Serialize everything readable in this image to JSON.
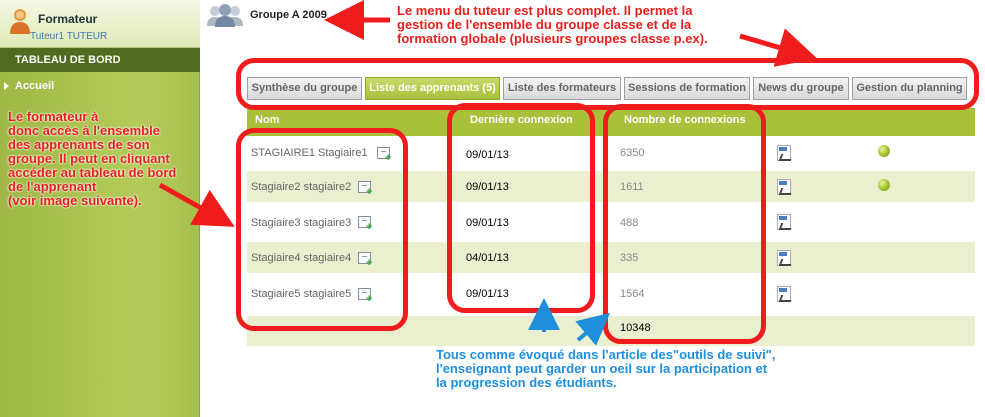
{
  "sidebar": {
    "role": "Formateur",
    "user": "Tuteur1 TUTEUR",
    "section_title": "TABLEAU DE BORD",
    "nav_item": "Accueil"
  },
  "header": {
    "group_name": "Groupe A 2009"
  },
  "tabs": [
    {
      "label": "Synthèse du groupe",
      "active": false
    },
    {
      "label": "Liste des apprenants (5)",
      "active": true
    },
    {
      "label": "Liste des formateurs",
      "active": false
    },
    {
      "label": "Sessions de formation",
      "active": false
    },
    {
      "label": "News du groupe",
      "active": false
    },
    {
      "label": "Gestion du planning",
      "active": false
    }
  ],
  "table": {
    "columns": [
      "Nom",
      "Dernière connexion",
      "Nombre de connexions"
    ],
    "rows": [
      {
        "name": "STAGIAIRE1 Stagiaire1",
        "last": "09/01/13",
        "count": "6350",
        "pdf": true,
        "dot": true
      },
      {
        "name": "Stagiaire2 stagiaire2",
        "last": "09/01/13",
        "count": "1611",
        "pdf": true,
        "dot": true
      },
      {
        "name": "Stagiaire3 stagiaire3",
        "last": "09/01/13",
        "count": "488",
        "pdf": true,
        "dot": false
      },
      {
        "name": "Stagiaire4 stagiaire4",
        "last": "04/01/13",
        "count": "335",
        "pdf": true,
        "dot": false
      },
      {
        "name": "Stagiaire5 stagiaire5",
        "last": "09/01/13",
        "count": "1564",
        "pdf": true,
        "dot": false
      }
    ],
    "total": "10348"
  },
  "annotations": {
    "top_right": [
      "Le menu du tuteur est plus complet. Il permet la",
      "gestion de l'ensemble du groupe classe et de la",
      "formation globale (plusieurs groupes classe p.ex)."
    ],
    "left": [
      "Le formateur à",
      "donc accès à l'ensemble",
      "des apprenants de son",
      "groupe. Il peut en cliquant",
      "accéder au tableau de bord",
      "de l'apprenant",
      "(voir image suivante)."
    ],
    "bottom": [
      "Tous comme évoqué dans l'article des\"outils de suivi\",",
      "l'enseignant peut garder un oeil sur la participation et",
      "la progression des étudiants."
    ]
  },
  "colors": {
    "accent_green": "#a9c03a",
    "sidebar_dark": "#4f6b1d",
    "annotation_red": "#e8201c",
    "annotation_blue": "#1f8fdc"
  }
}
